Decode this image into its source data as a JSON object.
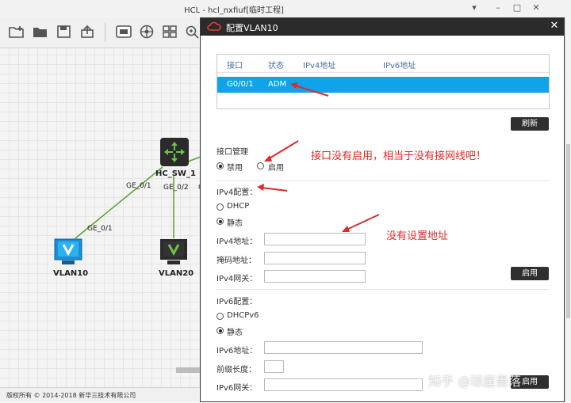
{
  "app": {
    "title": "HCL - hcl_nxfiuf[临时工程]"
  },
  "toolbar": {
    "icons": [
      "new-folder-icon",
      "open-folder-icon",
      "save-icon",
      "export-icon",
      "screenshot-icon",
      "settings-icon",
      "grid-icon",
      "zoom-icon"
    ]
  },
  "topology": {
    "switch_label": "HC_SW_1",
    "links": {
      "left_top": "GE_0/1",
      "left_bottom": "GE_0/1",
      "mid_top": "GE_0/2",
      "cut": "G"
    },
    "hosts": [
      {
        "label": "VLAN10"
      },
      {
        "label": "VLAN20"
      }
    ]
  },
  "status_bar": {
    "copyright": "版权所有 © 2014-2018 新华三技术有限公司"
  },
  "dialog": {
    "title": "配置VLAN10",
    "table": {
      "headers": [
        "接口",
        "状态",
        "IPv4地址",
        "IPv6地址"
      ],
      "rows": [
        {
          "interface": "G0/0/1",
          "status": "ADM",
          "ipv4": "",
          "ipv6": ""
        }
      ]
    },
    "refresh_button": "刷新",
    "interface_mgmt": {
      "label": "接口管理",
      "options": [
        "禁用",
        "启用"
      ],
      "selected": "禁用"
    },
    "ipv4": {
      "label": "IPv4配置：",
      "options": [
        "DHCP",
        "静态"
      ],
      "selected": "静态",
      "fields": [
        {
          "label": "IPv4地址：",
          "value": ""
        },
        {
          "label": "掩码地址：",
          "value": ""
        },
        {
          "label": "IPv4网关：",
          "value": ""
        }
      ],
      "enable_button": "启用"
    },
    "ipv6": {
      "label": "IPv6配置：",
      "options": [
        "DHCPv6",
        "静态"
      ],
      "selected": "静态",
      "fields": [
        {
          "label": "IPv6地址：",
          "value": ""
        },
        {
          "label": "前缀长度：",
          "value": ""
        },
        {
          "label": "IPv6网关：",
          "value": ""
        }
      ],
      "enable_button": "启用"
    }
  },
  "annotations": {
    "not_enabled": "接口没有启用，相当于没有接网线吧！",
    "no_address": "没有设置地址"
  },
  "watermark": "知乎 @琼崖墨落",
  "colors": {
    "selected_row": "#0fa4ea",
    "annotation": "#e02a2a",
    "dialog_title": "#2b2b2b",
    "host_vlan10": "#1b8fd6",
    "host_vlan20": "#2b2b2b",
    "link": "#5aa02c"
  }
}
